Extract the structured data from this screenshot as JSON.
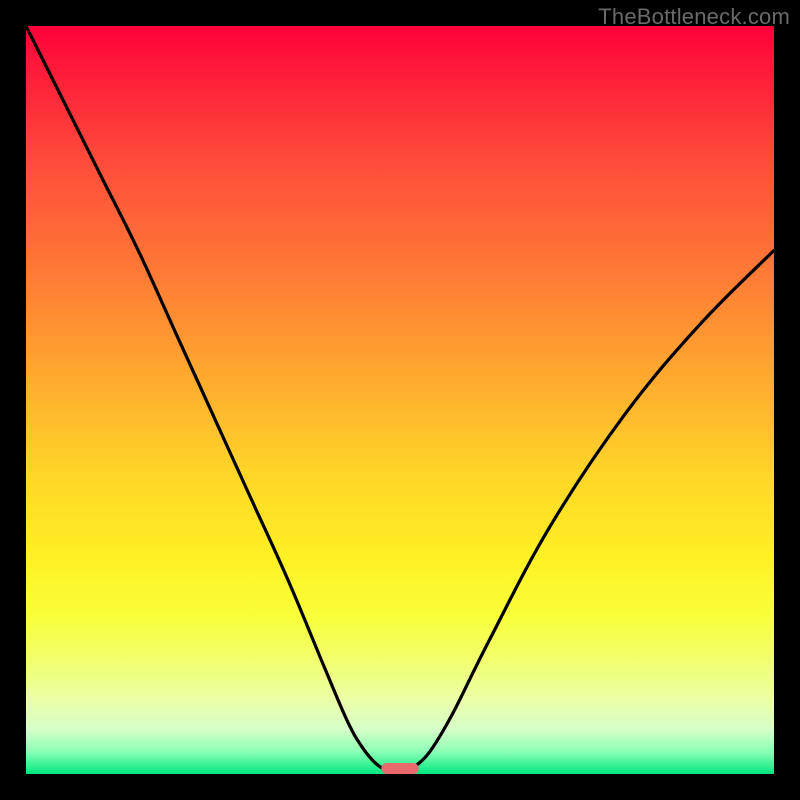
{
  "watermark": "TheBottleneck.com",
  "chart_data": {
    "type": "line",
    "title": "",
    "xlabel": "",
    "ylabel": "",
    "xlim": [
      0,
      100
    ],
    "ylim": [
      0,
      100
    ],
    "series": [
      {
        "name": "bottleneck-curve",
        "x": [
          0,
          5,
          10,
          15,
          20,
          25,
          30,
          35,
          40,
          43,
          45,
          47,
          49,
          50,
          51,
          52,
          54,
          57,
          62,
          70,
          80,
          90,
          100
        ],
        "y": [
          100,
          90,
          80,
          70,
          59,
          48,
          37,
          26,
          14,
          7,
          3.5,
          1.2,
          0.2,
          0,
          0.2,
          1,
          3,
          8,
          18,
          33,
          48,
          60,
          70
        ]
      }
    ],
    "marker": {
      "name": "min-marker",
      "x": 50,
      "width_pct": 5,
      "color": "#e96a6c"
    }
  }
}
